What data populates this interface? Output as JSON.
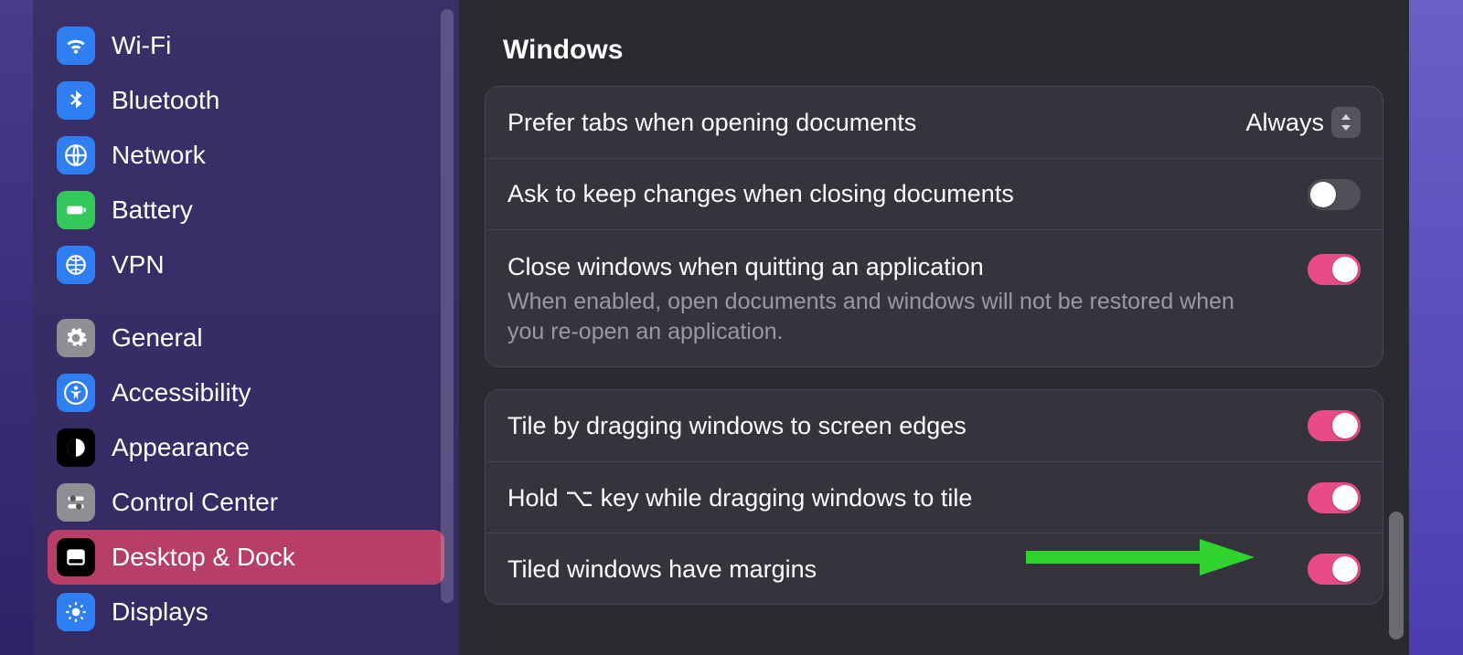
{
  "sidebar": {
    "items": [
      {
        "label": "Wi-Fi",
        "icon": "wifi",
        "color": "ic-blue"
      },
      {
        "label": "Bluetooth",
        "icon": "bluetooth",
        "color": "ic-blue"
      },
      {
        "label": "Network",
        "icon": "network",
        "color": "ic-blue"
      },
      {
        "label": "Battery",
        "icon": "battery",
        "color": "ic-green"
      },
      {
        "label": "VPN",
        "icon": "globe",
        "color": "ic-blue"
      }
    ],
    "items2": [
      {
        "label": "General",
        "icon": "gear",
        "color": "ic-gray"
      },
      {
        "label": "Accessibility",
        "icon": "accessibility",
        "color": "ic-blue"
      },
      {
        "label": "Appearance",
        "icon": "appearance",
        "color": "ic-black"
      },
      {
        "label": "Control Center",
        "icon": "sliders",
        "color": "ic-gray"
      },
      {
        "label": "Desktop & Dock",
        "icon": "dock",
        "color": "ic-black",
        "selected": true
      },
      {
        "label": "Displays",
        "icon": "brightness",
        "color": "ic-blue"
      }
    ]
  },
  "section": {
    "title": "Windows"
  },
  "panel1": {
    "prefer_tabs_label": "Prefer tabs when opening documents",
    "prefer_tabs_value": "Always",
    "ask_keep_label": "Ask to keep changes when closing documents",
    "ask_keep_on": false,
    "close_windows_label": "Close windows when quitting an application",
    "close_windows_sub": "When enabled, open documents and windows will not be restored when you re-open an application.",
    "close_windows_on": true
  },
  "panel2": {
    "tile_edges_label": "Tile by dragging windows to screen edges",
    "tile_edges_on": true,
    "hold_opt_label": "Hold ⌥ key while dragging windows to tile",
    "hold_opt_on": true,
    "margins_label": "Tiled windows have margins",
    "margins_on": true
  }
}
